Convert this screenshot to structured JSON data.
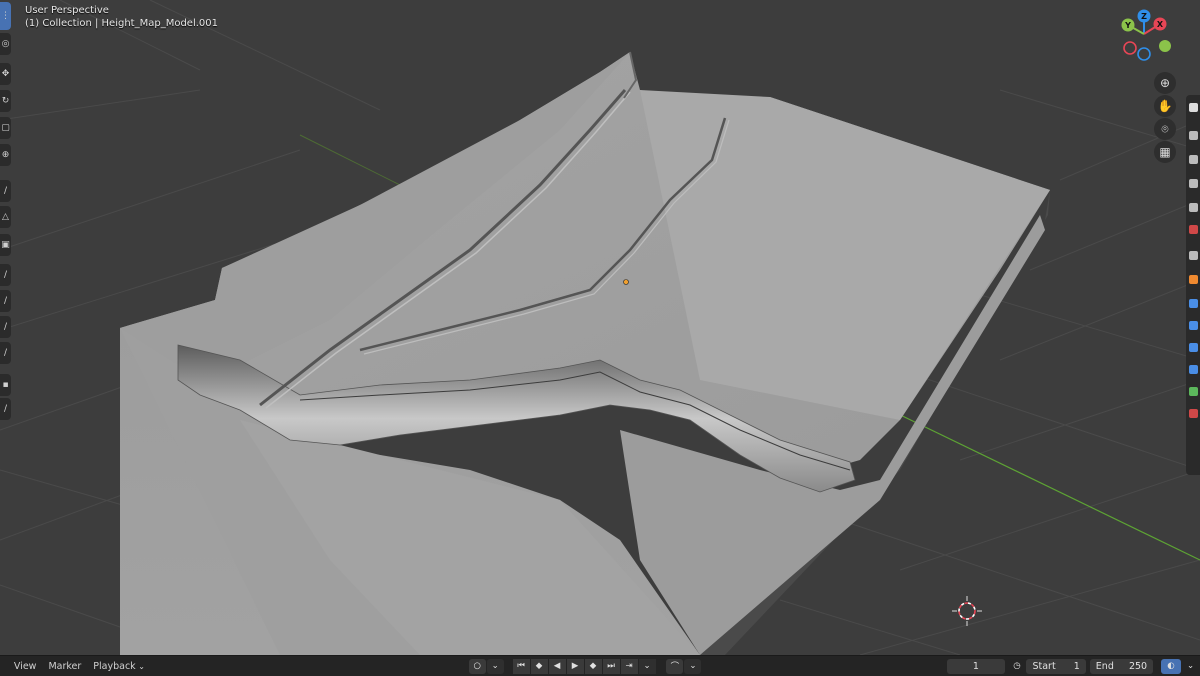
{
  "viewport": {
    "title": "User Perspective",
    "collection_label": "(1) Collection | Height_Map_Model.001"
  },
  "gizmo": {
    "axes": [
      {
        "label": "X",
        "color": "#e84656"
      },
      {
        "label": "Y",
        "color": "#8bc34a"
      },
      {
        "label": "Z",
        "color": "#2f8fea"
      }
    ]
  },
  "left_toolbar": {
    "tools": [
      "select-box-icon",
      "cursor-icon",
      "move-icon",
      "rotate-icon",
      "scale-icon",
      "transform-icon",
      "annotate-icon",
      "measure-icon",
      "add-cube-icon",
      "knife-icon",
      "bisect-icon",
      "poly-build-icon",
      "spin-icon",
      "smooth-icon",
      "shear-icon"
    ]
  },
  "nav_buttons": [
    "zoom-icon",
    "hand-pan-icon",
    "camera-icon",
    "grid-ortho-icon"
  ],
  "timeline": {
    "menus": {
      "view": "View",
      "marker": "Marker",
      "playback": "Playback"
    },
    "current_frame": "1",
    "start_label": "Start",
    "start_value": "1",
    "end_label": "End",
    "end_value": "250"
  },
  "colors": {
    "background": "#3d3d3d",
    "terrain": "#9a9a9a",
    "x_axis": "#b43c3c",
    "y_axis": "#5da334",
    "accent": "#4772b3"
  }
}
